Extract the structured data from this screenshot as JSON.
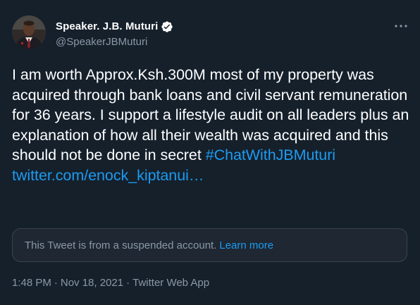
{
  "author": {
    "display_name": "Speaker. J.B. Muturi",
    "handle": "@SpeakerJBMuturi",
    "verified": true
  },
  "tweet": {
    "text": "I am worth Approx.Ksh.300M most of my property was acquired through bank loans and civil servant remuneration for 36 years. I support a lifestyle audit on all leaders plus an explanation of how all their wealth was acquired and this should not be done in secret",
    "hashtag": "#ChatWithJBMuturi",
    "link": "twitter.com/enock_kiptanui…"
  },
  "notice": {
    "message": "This Tweet is from a suspended account.",
    "learn_more": "Learn more"
  },
  "meta": {
    "time": "1:48 PM",
    "separator": "·",
    "date": "Nov 18, 2021",
    "client": "Twitter Web App"
  },
  "icons": {
    "verified": "verified-badge-icon",
    "more": "more-horizontal-icon"
  },
  "colors": {
    "background": "#15202b",
    "link": "#1d9bf0",
    "secondary_text": "#8b98a5",
    "card_background": "#1e2732",
    "card_border": "#38444d"
  }
}
